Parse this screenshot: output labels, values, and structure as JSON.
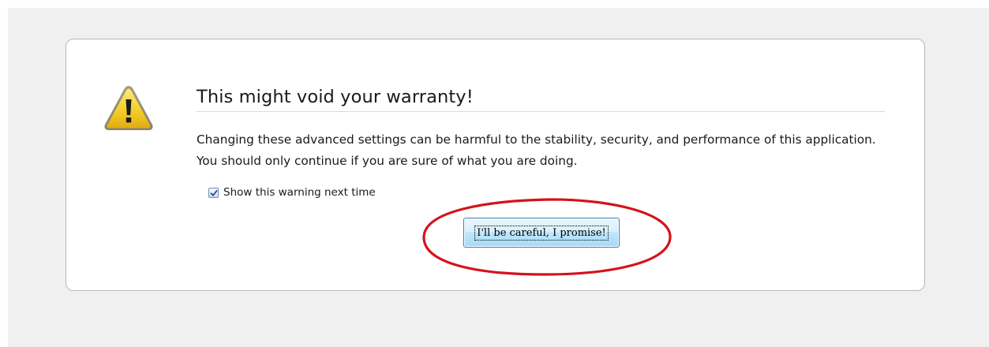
{
  "dialog": {
    "title": "This might void your warranty!",
    "message": "Changing these advanced settings can be harmful to the stability, security, and performance of this application. You should only continue if you are sure of what you are doing.",
    "checkbox": {
      "label": "Show this warning next time",
      "checked": true
    },
    "confirm_button_label": "I'll be careful, I promise!"
  },
  "icons": {
    "warning": "warning-triangle-icon"
  },
  "annotation": {
    "shape": "red ellipse around confirm button"
  },
  "colors": {
    "page_background": "#f0f0f0",
    "card_background": "#ffffff",
    "warning_yellow": "#f3cf2a",
    "annotation_red": "#d4121c",
    "button_border": "#3c7fb1"
  }
}
